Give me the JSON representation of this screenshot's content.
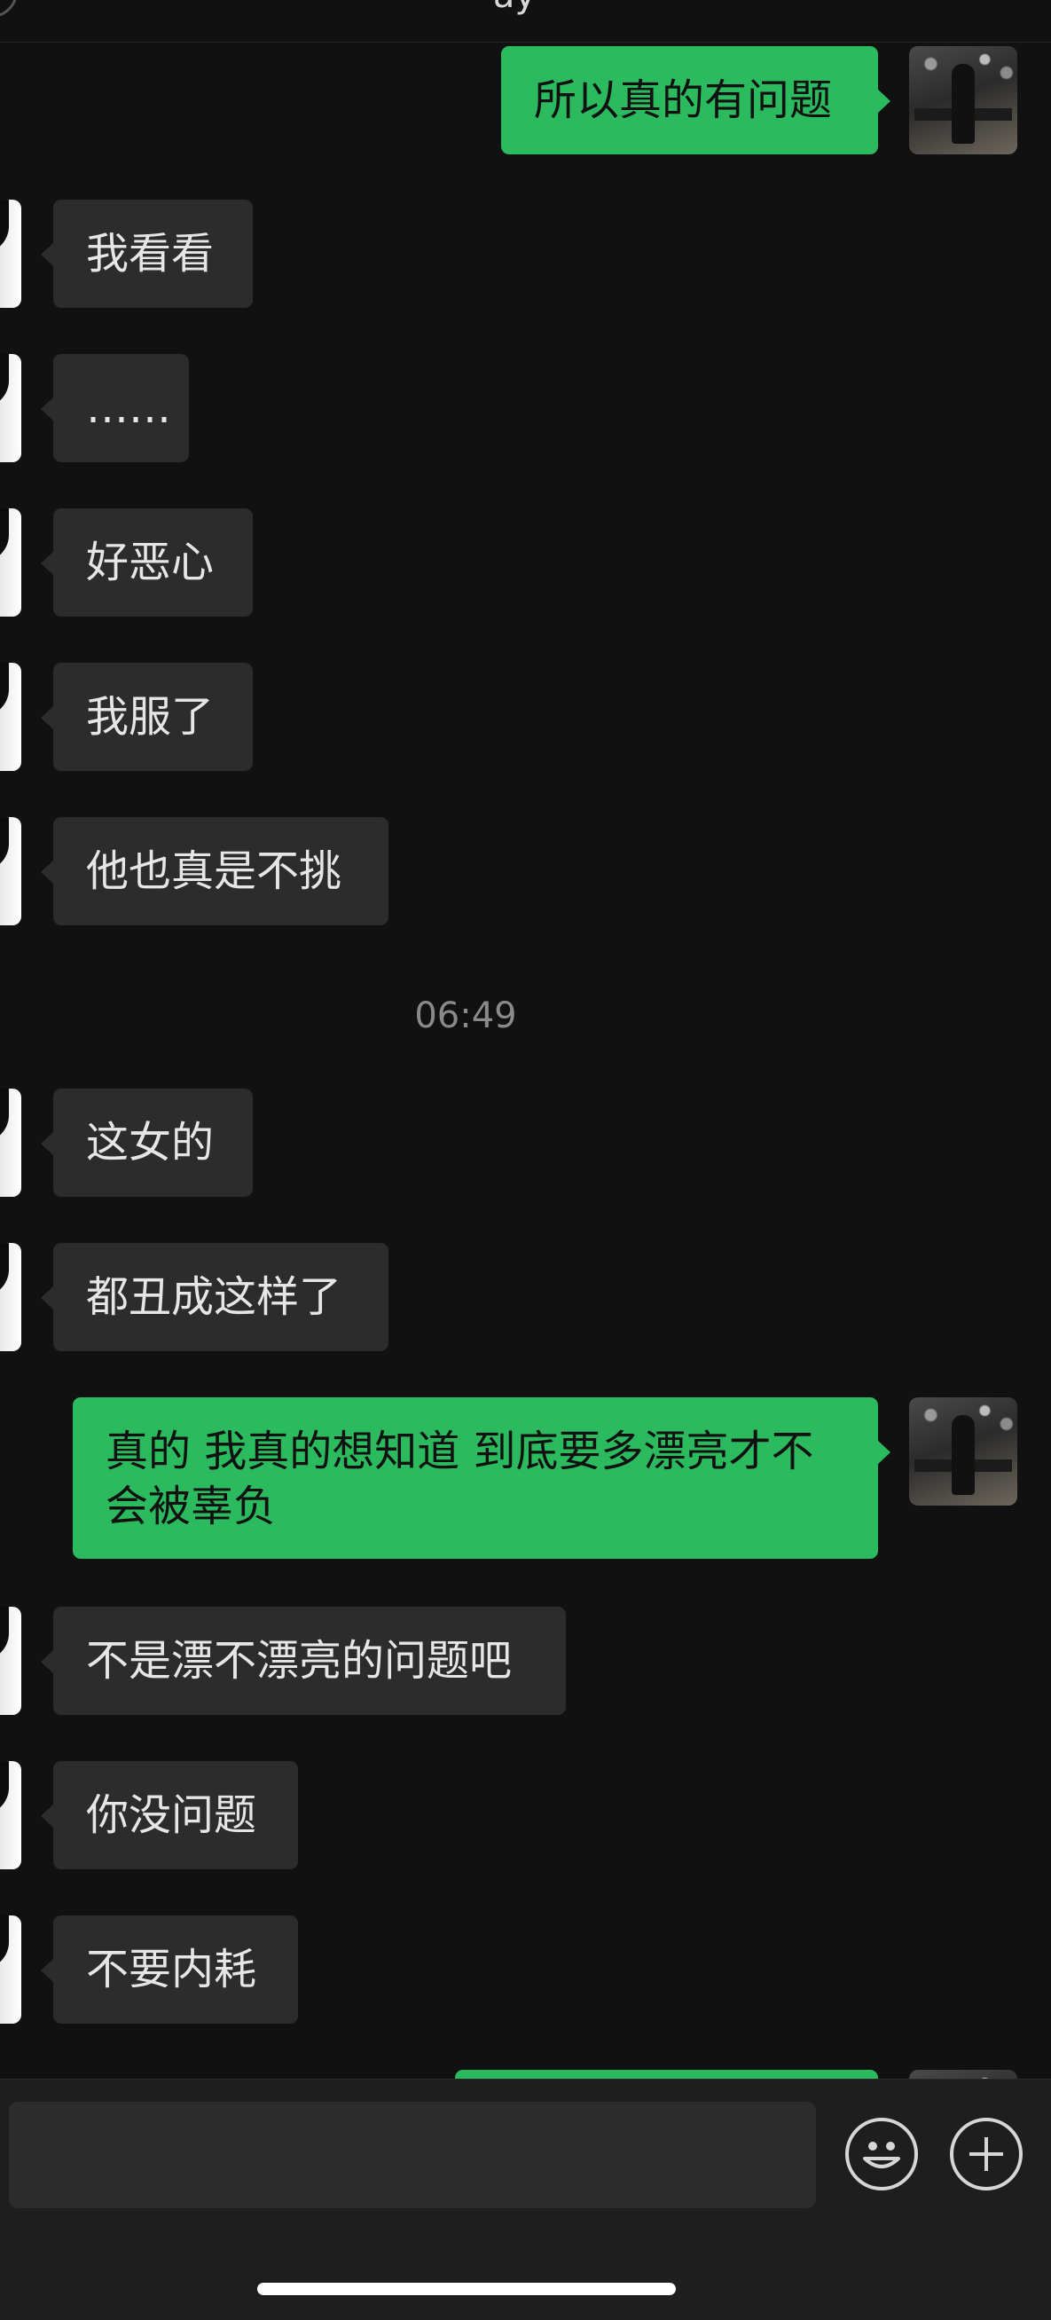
{
  "header": {
    "title": "ay"
  },
  "messages": [
    {
      "side": "out",
      "text": "所以真的有问题"
    },
    {
      "side": "in",
      "text": "我看看"
    },
    {
      "side": "in",
      "text": "……"
    },
    {
      "side": "in",
      "text": "好恶心"
    },
    {
      "side": "in",
      "text": "我服了"
    },
    {
      "side": "in",
      "text": "他也真是不挑"
    },
    {
      "side": "time",
      "text": "06:49"
    },
    {
      "side": "in",
      "text": "这女的"
    },
    {
      "side": "in",
      "text": "都丑成这样了"
    },
    {
      "side": "out",
      "text": "真的 我真的想知道 到底要多漂亮才不会被辜负"
    },
    {
      "side": "in",
      "text": "不是漂不漂亮的问题吧"
    },
    {
      "side": "in",
      "text": "你没问题"
    },
    {
      "side": "in",
      "text": "不要内耗"
    },
    {
      "side": "out",
      "text": ""
    }
  ],
  "input": {
    "placeholder": ""
  },
  "icons": {
    "emoji": "smiley-icon",
    "more": "plus-icon"
  },
  "colors": {
    "background": "#111111",
    "incoming_bubble": "#2c2c2c",
    "outgoing_bubble": "#2bba5e"
  }
}
